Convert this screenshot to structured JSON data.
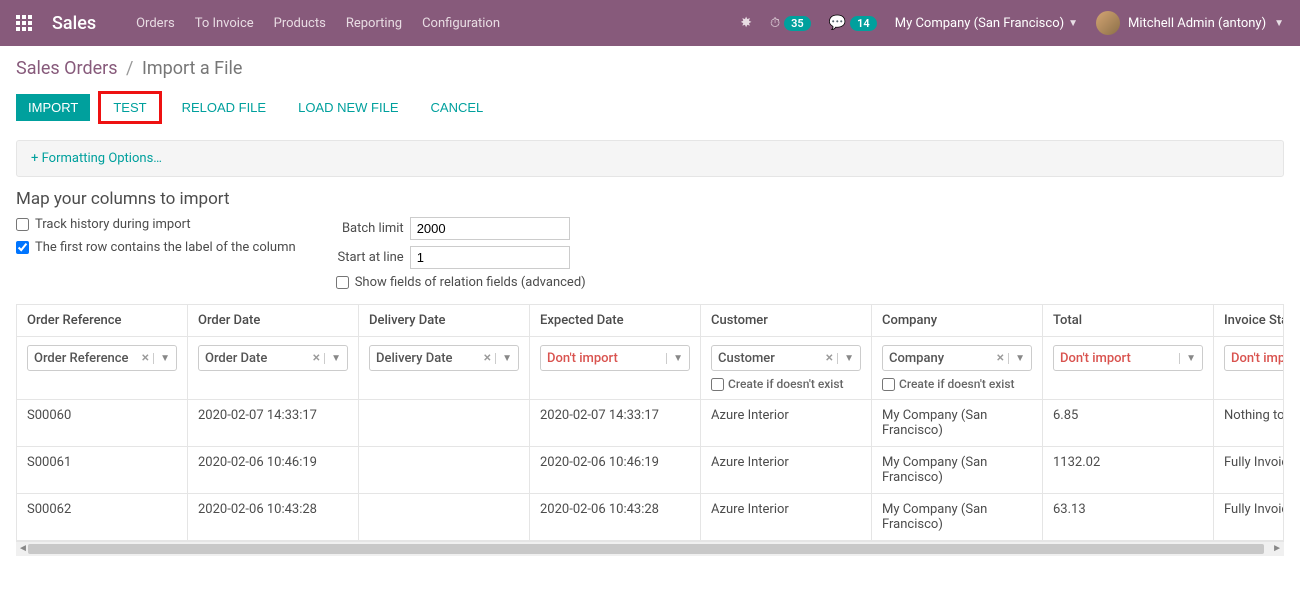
{
  "nav": {
    "brand": "Sales",
    "items": [
      "Orders",
      "To Invoice",
      "Products",
      "Reporting",
      "Configuration"
    ],
    "clock_badge": "35",
    "comment_badge": "14",
    "company": "My Company (San Francisco)",
    "user": "Mitchell Admin (antony)"
  },
  "breadcrumb": {
    "root": "Sales Orders",
    "current": "Import a File"
  },
  "actions": {
    "import": "Import",
    "test": "Test",
    "reload": "Reload File",
    "load_new": "Load New File",
    "cancel": "Cancel"
  },
  "formatting_link": "+ Formatting Options…",
  "section_title": "Map your columns to import",
  "options": {
    "track_history": "Track history during import",
    "first_row_label": "The first row contains the label of the column",
    "batch_limit_label": "Batch limit",
    "batch_limit_value": "2000",
    "start_line_label": "Start at line",
    "start_line_value": "1",
    "show_relation": "Show fields of relation fields (advanced)"
  },
  "columns": [
    {
      "header": "Order Reference",
      "selected": "Order Reference",
      "red": false,
      "has_x": true,
      "create_if": false
    },
    {
      "header": "Order Date",
      "selected": "Order Date",
      "red": false,
      "has_x": true,
      "create_if": false
    },
    {
      "header": "Delivery Date",
      "selected": "Delivery Date",
      "red": false,
      "has_x": true,
      "create_if": false
    },
    {
      "header": "Expected Date",
      "selected": "Don't import",
      "red": true,
      "has_x": false,
      "create_if": false
    },
    {
      "header": "Customer",
      "selected": "Customer",
      "red": false,
      "has_x": true,
      "create_if": true
    },
    {
      "header": "Company",
      "selected": "Company",
      "red": false,
      "has_x": true,
      "create_if": true
    },
    {
      "header": "Total",
      "selected": "Don't import",
      "red": true,
      "has_x": false,
      "create_if": false
    },
    {
      "header": "Invoice Status",
      "selected": "Don't import",
      "red": true,
      "has_x": false,
      "create_if": false
    }
  ],
  "create_if_label": "Create if doesn't exist",
  "rows": [
    {
      "ref": "S00060",
      "odate": "2020-02-07 14:33:17",
      "ddate": "",
      "edate": "2020-02-07 14:33:17",
      "cust": "Azure Interior",
      "comp": "My Company (San Francisco)",
      "total": "6.85",
      "inv": "Nothing to Invoice"
    },
    {
      "ref": "S00061",
      "odate": "2020-02-06 10:46:19",
      "ddate": "",
      "edate": "2020-02-06 10:46:19",
      "cust": "Azure Interior",
      "comp": "My Company (San Francisco)",
      "total": "1132.02",
      "inv": "Fully Invoiced"
    },
    {
      "ref": "S00062",
      "odate": "2020-02-06 10:43:28",
      "ddate": "",
      "edate": "2020-02-06 10:43:28",
      "cust": "Azure Interior",
      "comp": "My Company (San Francisco)",
      "total": "63.13",
      "inv": "Fully Invoiced"
    }
  ]
}
